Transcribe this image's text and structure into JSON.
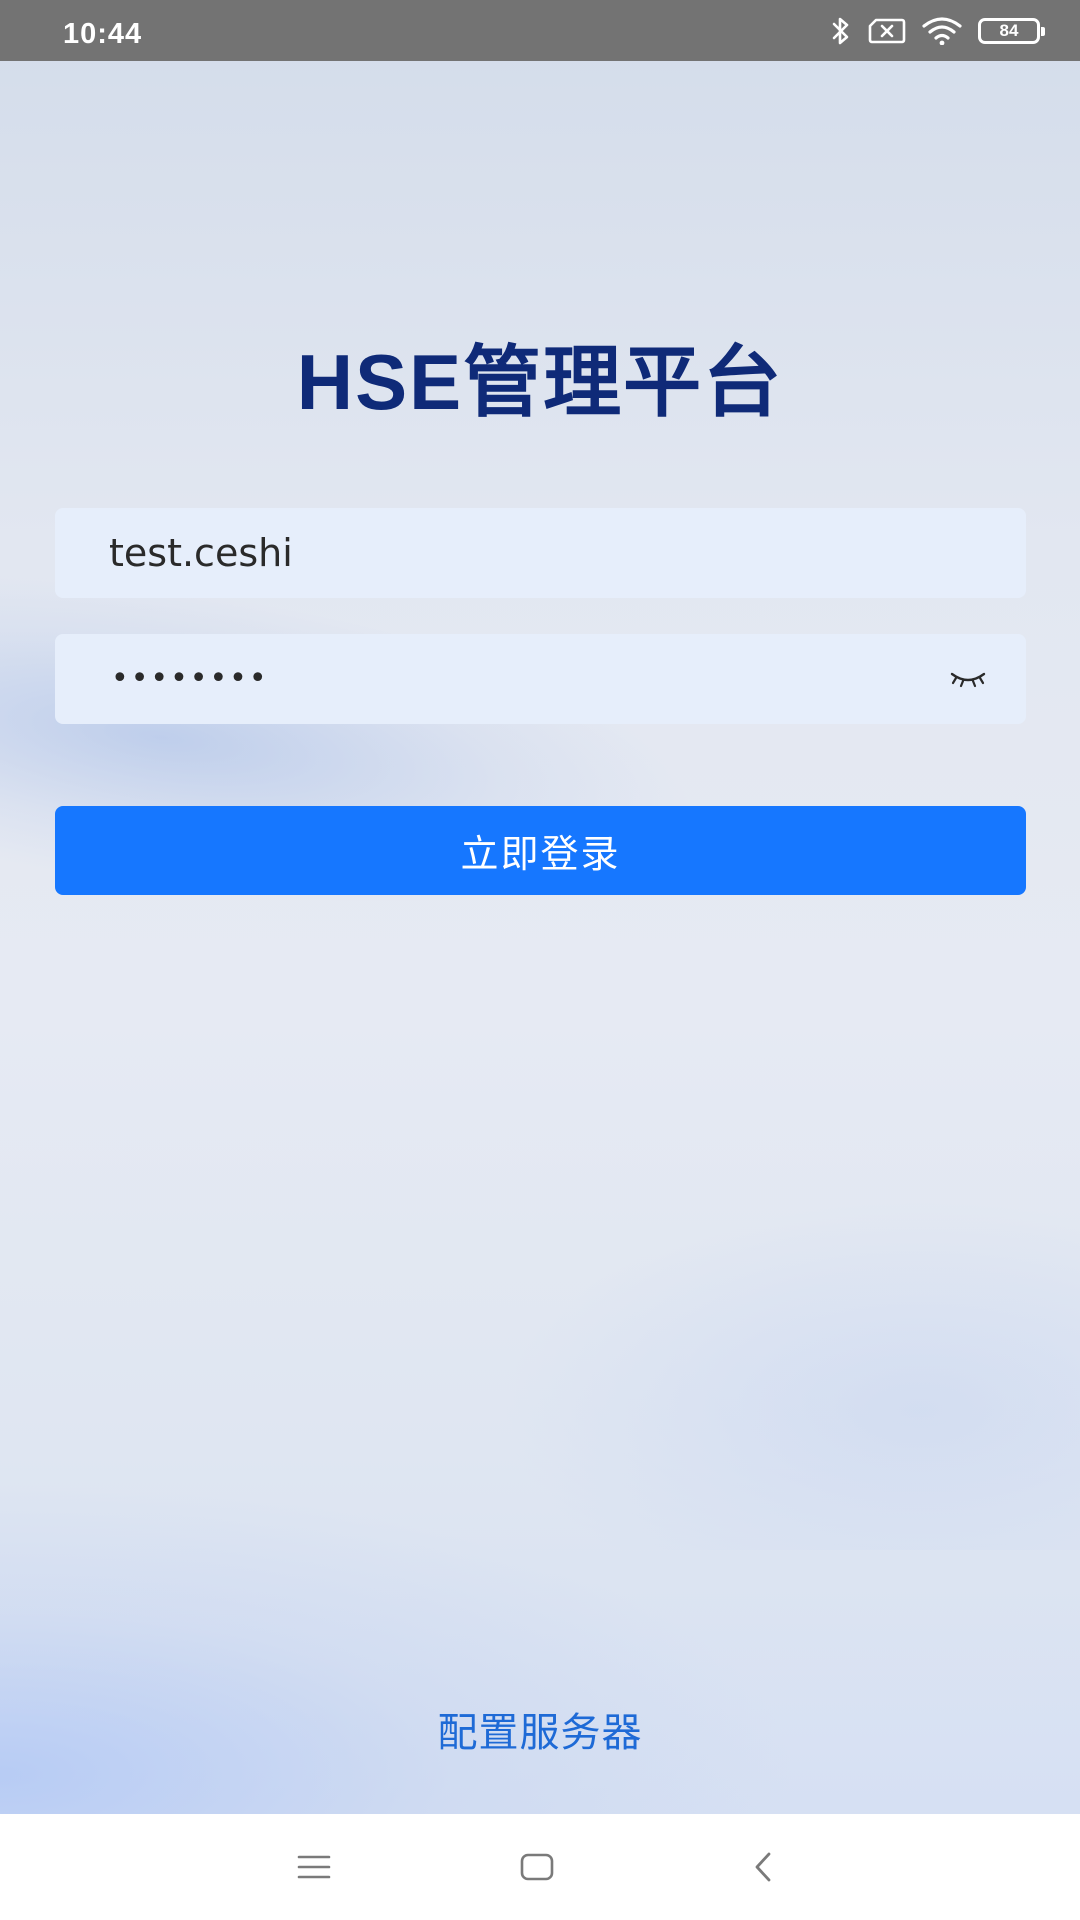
{
  "status_bar": {
    "time": "10:44",
    "icons": [
      "bluetooth-icon",
      "no-sim-icon",
      "wifi-icon",
      "battery-icon"
    ],
    "battery_level": "84"
  },
  "app": {
    "title": "HSE管理平台"
  },
  "login_form": {
    "username_value": "test.ceshi",
    "password_masked": "••••••••",
    "password_toggle_icon": "eye-closed-icon",
    "submit_label": "立即登录"
  },
  "footer": {
    "config_server_label": "配置服务器"
  },
  "nav_bar": {
    "icons": [
      "menu-icon",
      "home-icon",
      "back-icon"
    ]
  },
  "colors": {
    "title": "#0f2a78",
    "primary_button": "#1677ff",
    "link": "#1e6ad6",
    "input_background": "#e6eefb",
    "status_bar": "#737373"
  }
}
